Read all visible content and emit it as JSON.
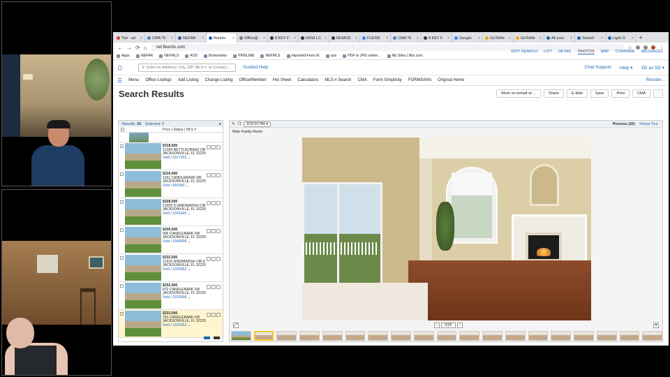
{
  "browser": {
    "tabs": [
      {
        "title": "Tiet - ad",
        "color": "#d44638",
        "active": false
      },
      {
        "title": "CMA Til",
        "color": "#4a86c5",
        "active": false
      },
      {
        "title": "NEFAR",
        "color": "#3b5998",
        "active": false
      },
      {
        "title": "flexmls",
        "color": "#1f66b5",
        "active": true
      },
      {
        "title": "Office@",
        "color": "#7a7a7a",
        "active": false
      },
      {
        "title": "8 KEY F",
        "color": "#333333",
        "active": false
      },
      {
        "title": "HOW LC",
        "color": "#333333",
        "active": false
      },
      {
        "title": "REMOD",
        "color": "#333333",
        "active": false
      },
      {
        "title": "FLEXM",
        "color": "#4285f4",
        "active": false
      },
      {
        "title": "CMA Til",
        "color": "#4a86c5",
        "active": false
      },
      {
        "title": "8 KEY F",
        "color": "#333333",
        "active": false
      },
      {
        "title": "Google",
        "color": "#4285f4",
        "active": false
      },
      {
        "title": "GoToMe",
        "color": "#f6a623",
        "active": false
      },
      {
        "title": "GoToMe",
        "color": "#f6a623",
        "active": false
      },
      {
        "title": "All your",
        "color": "#1f66b5",
        "active": false
      },
      {
        "title": "Search",
        "color": "#1f66b5",
        "active": false
      },
      {
        "title": "Light O",
        "color": "#1f66b5",
        "active": false
      }
    ],
    "new_tab": "+",
    "url": "nef.flexmls.com",
    "bookmarks": [
      "Apps",
      "NEFAR",
      "NEFMLS",
      "AOS",
      "Bookmarks",
      "PIPELINE",
      "NEFMLS",
      "Imported From IE",
      "aos",
      "PDF to JPG online...",
      "My Sites | Wix.com"
    ]
  },
  "app": {
    "search_placeholder": "Enter an Address, City, ZIP, MLS #, or Contact...",
    "guided_help": "Guided Help",
    "header_links": [
      "Chat Support",
      "Help ▾",
      "SD as SD ▾"
    ],
    "menu_label": "Menu",
    "menu_items": [
      "Office Listings",
      "Add Listing",
      "Change Listing",
      "Office/Member",
      "Hot Sheet",
      "Calculators",
      "MLS # Search",
      "CMA",
      "Form Simplicity",
      "FORMS/Info",
      "Original Home"
    ],
    "reorder": "Reorder...",
    "page_title": "Search Results",
    "actions": [
      "Work on behalf of ...",
      "Share",
      "E-Mail",
      "Save",
      "Print",
      "CMA"
    ],
    "view_tabs": [
      {
        "label": "EDIT SEARCH",
        "active": false
      },
      {
        "label": "LIST",
        "active": false
      },
      {
        "label": "DETAIL",
        "active": false
      },
      {
        "label": "PHOTOS",
        "active": true
      },
      {
        "label": "MAP",
        "active": false
      },
      {
        "label": "COMPARE",
        "active": false
      },
      {
        "label": "MESSAGES",
        "active": false
      }
    ]
  },
  "results": {
    "results_label": "Results:",
    "results_count": "28",
    "selected_label": "Selected:",
    "selected_count": "0",
    "columns_label": "Price | Status | MLS #",
    "rows": [
      {
        "price": "$318,000",
        "address": "12184 NETTLECREEK DR",
        "city": "JACKSONVILLE, FL 32225",
        "status": "Sold",
        "mls": "1017263",
        "highlight": false
      },
      {
        "price": "$319,900",
        "address": "1181 CANDLEBARK DR",
        "city": "JACKSONVILLE, FL 32225",
        "status": "Sold",
        "mls": "991963",
        "highlight": false
      },
      {
        "price": "$328,000",
        "address": "12255 S HINDMARSH CIR",
        "city": "JACKSONVILLE, FL 32225",
        "status": "Sold",
        "mls": "1041640",
        "highlight": false
      },
      {
        "price": "$330,000",
        "address": "996 CANDLEBARK DR",
        "city": "JACKSONVILLE, FL 32225",
        "status": "Sold",
        "mls": "1040998",
        "highlight": false
      },
      {
        "price": "$332,500",
        "address": "12310 HINDMARSH CIR E",
        "city": "JACKSONVILLE, FL 32225",
        "status": "Sold",
        "mls": "1030562",
        "highlight": false
      },
      {
        "price": "$332,900",
        "address": "872 CANDLEBARK DR",
        "city": "JACKSONVILLE, FL 32225",
        "status": "Sold",
        "mls": "1033698",
        "highlight": false
      },
      {
        "price": "$333,000",
        "address": "781 CANDLEBARK DR",
        "city": "JACKSONVILLE, FL 32225",
        "status": "Sold",
        "mls": "1026362",
        "highlight": true
      }
    ]
  },
  "photos": {
    "selector": "DSC01784 ▾",
    "pictures_label": "Pictures (26)",
    "virtual_tour": "Virtual Tour",
    "caption": "Main Family Room",
    "counter": "2/26",
    "prev": "‹",
    "next": "›",
    "expand": "⤢",
    "down": "▾"
  }
}
